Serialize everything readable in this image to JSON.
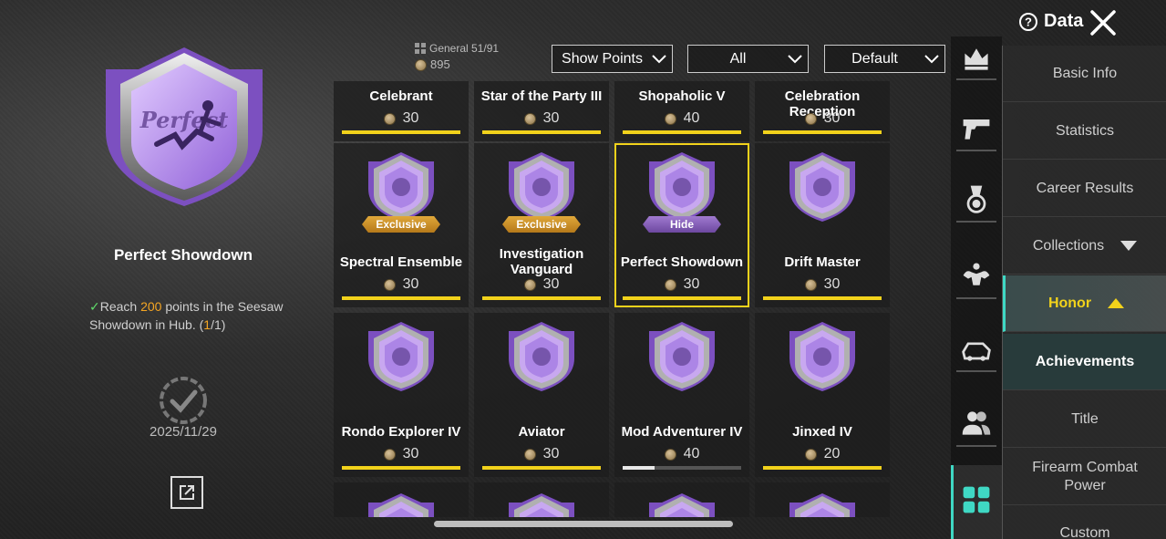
{
  "header": {
    "data_label": "Data"
  },
  "detail": {
    "title": "Perfect Showdown",
    "requirement": {
      "prefix": "Reach ",
      "highlight": "200",
      "middle": " points in the Seesaw Showdown in Hub. (",
      "progress_current": "1",
      "progress_sep": "/1)"
    },
    "date": "2025/11/29"
  },
  "filter_bar": {
    "category": "General  51/91",
    "points": "895",
    "dropdown1": "Show Points",
    "dropdown2": "All",
    "dropdown3": "Default"
  },
  "achievements": [
    {
      "name": "Celebrant",
      "points": "30",
      "tag": "",
      "progress": 1.0
    },
    {
      "name": "Star of the Party III",
      "points": "30",
      "tag": "",
      "progress": 1.0
    },
    {
      "name": "Shopaholic V",
      "points": "40",
      "tag": "",
      "progress": 1.0
    },
    {
      "name": "Celebration Reception",
      "points": "30",
      "tag": "",
      "progress": 1.0
    },
    {
      "name": "Spectral Ensemble",
      "points": "30",
      "tag": "Exclusive",
      "progress": 1.0
    },
    {
      "name": "Investigation Vanguard",
      "points": "30",
      "tag": "Exclusive",
      "progress": 1.0
    },
    {
      "name": "Perfect Showdown",
      "points": "30",
      "tag": "Hide",
      "progress": 1.0,
      "selected": true
    },
    {
      "name": "Drift Master",
      "points": "30",
      "tag": "",
      "progress": 1.0
    },
    {
      "name": "Rondo Explorer IV",
      "points": "30",
      "tag": "",
      "progress": 1.0
    },
    {
      "name": "Aviator",
      "points": "30",
      "tag": "",
      "progress": 1.0
    },
    {
      "name": "Mod Adventurer IV",
      "points": "40",
      "tag": "",
      "progress": 0.27
    },
    {
      "name": "Jinxed IV",
      "points": "20",
      "tag": "",
      "progress": 1.0
    }
  ],
  "side_icons": [
    "crown-icon",
    "pistol-icon",
    "medal-icon",
    "muscle-icon",
    "vehicle-icon",
    "team-icon",
    "collection-grid-icon"
  ],
  "menu": {
    "basic_info": "Basic Info",
    "statistics": "Statistics",
    "career_results": "Career Results",
    "collections": "Collections",
    "honor": "Honor",
    "achievements": "Achievements",
    "title": "Title",
    "firearm": "Firearm Combat Power",
    "custom": "Custom"
  },
  "colors": {
    "accent_yellow": "#f2d21b",
    "accent_teal": "#3fd8c4",
    "badge_purple": "#a77ce0",
    "highlight_orange": "#f5a623"
  }
}
